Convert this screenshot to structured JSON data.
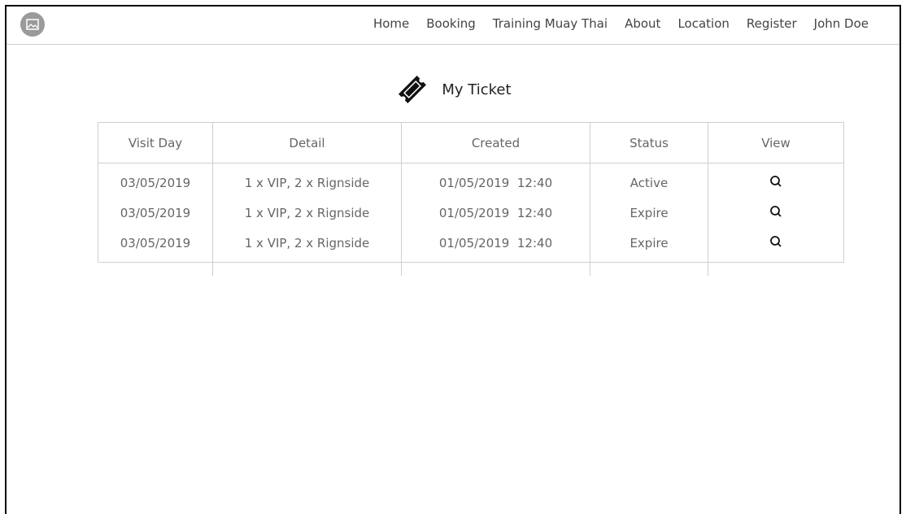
{
  "nav": {
    "logo_icon": "image-placeholder-icon",
    "items": [
      "Home",
      "Booking",
      "Training Muay Thai",
      "About",
      "Location",
      "Register",
      "John Doe"
    ]
  },
  "page": {
    "title": "My Ticket",
    "icon": "ticket-icon"
  },
  "table": {
    "headers": [
      "Visit Day",
      "Detail",
      "Created",
      "Status",
      "View"
    ],
    "rows": [
      {
        "visit_day": "03/05/2019",
        "detail": "1 x VIP, 2 x Rignside",
        "created": "01/05/2019  12:40",
        "status": "Active",
        "view_icon": "search-icon"
      },
      {
        "visit_day": "03/05/2019",
        "detail": "1 x VIP, 2 x Rignside",
        "created": "01/05/2019  12:40",
        "status": "Expire",
        "view_icon": "search-icon"
      },
      {
        "visit_day": "03/05/2019",
        "detail": "1 x VIP, 2 x Rignside",
        "created": "01/05/2019  12:40",
        "status": "Expire",
        "view_icon": "search-icon"
      }
    ]
  },
  "colors": {
    "border": "#cfcfcf",
    "logo": "#9a9a9a",
    "text": "#555555"
  }
}
